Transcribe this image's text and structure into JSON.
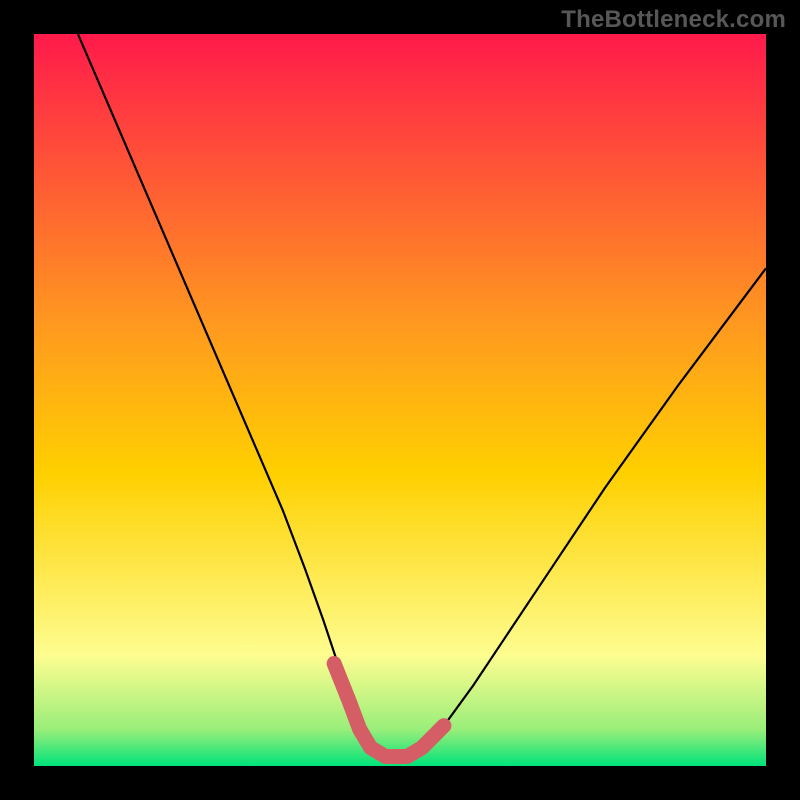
{
  "watermark": "TheBottleneck.com",
  "colors": {
    "black": "#000000",
    "curve": "#000000",
    "highlight": "#d45d66",
    "grad_top": "#ff1a4b",
    "grad_mid": "#ffd000",
    "grad_low": "#fdfd90",
    "grad_bottom": "#00e37a"
  },
  "chart_data": {
    "type": "line",
    "title": "",
    "xlabel": "",
    "ylabel": "",
    "xlim": [
      0,
      100
    ],
    "ylim": [
      0,
      100
    ],
    "grid": false,
    "background_gradient": [
      "#ff1a4b",
      "#ffd000",
      "#fdfd90",
      "#00e37a"
    ],
    "series": [
      {
        "name": "bottleneck-curve",
        "x": [
          6,
          10,
          14,
          18,
          22,
          26,
          30,
          34,
          37,
          39.5,
          41.5,
          43,
          44.5,
          46,
          48,
          51,
          53,
          56,
          60,
          64,
          70,
          78,
          88,
          100
        ],
        "y": [
          100,
          90.7,
          81.4,
          72.1,
          62.8,
          53.5,
          44.2,
          34.9,
          27,
          20,
          14,
          9,
          5,
          2.5,
          1.3,
          1.3,
          2.5,
          5.5,
          11,
          17,
          26,
          38,
          52,
          68
        ]
      }
    ],
    "highlight": {
      "name": "valley-floor",
      "x_range": [
        41,
        56
      ],
      "y_approx": [
        14,
        1.3,
        1.3,
        5.5
      ]
    }
  }
}
